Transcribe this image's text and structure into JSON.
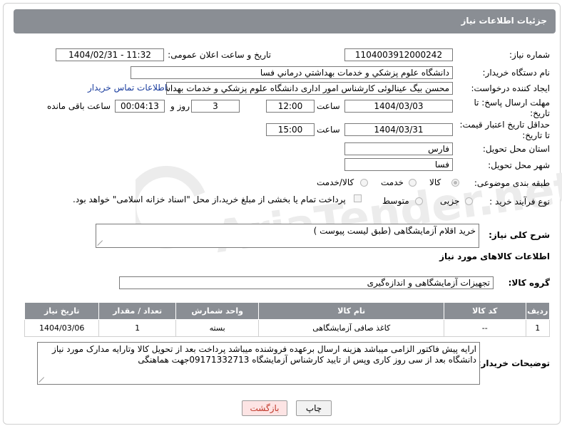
{
  "header": {
    "title": "جزئیات اطلاعات نیاز"
  },
  "fields": {
    "need_number_label": "شماره نیاز:",
    "need_number": "1104003912000242",
    "announce_label": "تاریخ و ساعت اعلان عمومی:",
    "announce_value": "1404/02/31 - 11:32",
    "buyer_org_label": "نام دستگاه خریدار:",
    "buyer_org": "دانشگاه علوم پزشکي و خدمات بهداشتي درماني فسا",
    "requester_label": "ایجاد کننده درخواست:",
    "requester": "محسن بیگ عینالوئی کارشناس امور اداری دانشگاه علوم پزشکي و خدمات بهداشتي درماني فسا",
    "buyer_contact_link": "اطلاعات تماس خریدار",
    "deadline_label_1": "مهلت ارسال پاسخ: تا",
    "deadline_label_2": "تاریخ:",
    "deadline_date": "1404/03/03",
    "time_word": "ساعت",
    "deadline_time": "12:00",
    "days_value": "3",
    "days_and_label": "روز و",
    "remaining_value": "00:04:13",
    "remaining_label": "ساعت باقی مانده",
    "price_validity_label_1": "حداقل تاریخ اعتبار قیمت:",
    "price_validity_label_2": "تا تاریخ:",
    "validity_date": "1404/03/31",
    "validity_time": "15:00",
    "province_label": "استان محل تحویل:",
    "province": "فارس",
    "city_label": "شهر محل تحویل:",
    "city": "فسا",
    "category_label": "طبقه بندی موضوعی:",
    "category_options": [
      "کالا",
      "خدمت",
      "کالا/خدمت"
    ],
    "category_selected": "کالا",
    "process_label": "نوع فرآیند خرید :",
    "process_options": [
      "جزیی",
      "متوسط"
    ],
    "payment_note": "پرداخت تمام یا بخشی از مبلغ خرید،از محل \"اسناد خزانه اسلامی\" خواهد بود.",
    "summary_label": "شرح کلی نیاز:",
    "summary_value": "خرید اقلام آزمایشگاهی (طبق لیست پیوست )"
  },
  "goods": {
    "section_title": "اطلاعات کالاهای مورد نیاز",
    "group_label": "گروه کالا:",
    "group_value": "تجهیزات آزمایشگاهی و اندازه‌گیری",
    "columns": [
      "ردیف",
      "کد کالا",
      "نام کالا",
      "واحد شمارش",
      "تعداد / مقدار",
      "تاریخ نیاز"
    ],
    "rows": [
      {
        "row": "1",
        "code": "--",
        "name": "کاغذ صافی آزمایشگاهی",
        "unit": "بسته",
        "qty": "1",
        "date": "1404/03/06"
      }
    ]
  },
  "buyer_notes": {
    "label": "توضیحات خریدار:",
    "text": "ارایه پیش فاکتور الزامی میباشد هزینه ارسال برعهده فروشنده میباشد پرداخت بعد از تحویل کالا وتارایه مدارک مورد نیاز دانشگاه بعد از سی روز کاری وپس از تایید کارشناس آزمایشگاه 09171332713جهت هماهنگی"
  },
  "buttons": {
    "print": "چاپ",
    "back": "بازگشت"
  },
  "watermark": {
    "text": "AriaTender.net"
  },
  "colors": {
    "header_bg": "#8a8e94",
    "link": "#1a3d9e",
    "back_text": "#c0392b",
    "back_bg": "#fde4e4",
    "watermark": "#ececec"
  }
}
